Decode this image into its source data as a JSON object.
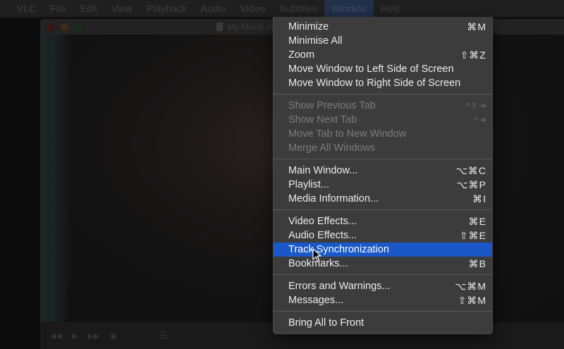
{
  "menubar": {
    "items": [
      "",
      "VLC",
      "File",
      "Edit",
      "View",
      "Playback",
      "Audio",
      "Video",
      "Subtitles",
      "Window",
      "Help"
    ],
    "active_index": 9
  },
  "player": {
    "title": "My Movie.mp4"
  },
  "window_menu": {
    "groups": [
      [
        {
          "label": "Minimize",
          "shortcut": "⌘M",
          "enabled": true
        },
        {
          "label": "Minimise All",
          "shortcut": "",
          "enabled": true
        },
        {
          "label": "Zoom",
          "shortcut": "⇧⌘Z",
          "enabled": true
        },
        {
          "label": "Move Window to Left Side of Screen",
          "shortcut": "",
          "enabled": true
        },
        {
          "label": "Move Window to Right Side of Screen",
          "shortcut": "",
          "enabled": true
        }
      ],
      [
        {
          "label": "Show Previous Tab",
          "shortcut": "^⇧⇥",
          "enabled": false
        },
        {
          "label": "Show Next Tab",
          "shortcut": "^⇥",
          "enabled": false
        },
        {
          "label": "Move Tab to New Window",
          "shortcut": "",
          "enabled": false
        },
        {
          "label": "Merge All Windows",
          "shortcut": "",
          "enabled": false
        }
      ],
      [
        {
          "label": "Main Window...",
          "shortcut": "⌥⌘C",
          "enabled": true
        },
        {
          "label": "Playlist...",
          "shortcut": "⌥⌘P",
          "enabled": true
        },
        {
          "label": "Media Information...",
          "shortcut": "⌘I",
          "enabled": true
        }
      ],
      [
        {
          "label": "Video Effects...",
          "shortcut": "⌘E",
          "enabled": true
        },
        {
          "label": "Audio Effects...",
          "shortcut": "⇧⌘E",
          "enabled": true
        },
        {
          "label": "Track Synchronization",
          "shortcut": "",
          "enabled": true,
          "highlighted": true
        },
        {
          "label": "Bookmarks...",
          "shortcut": "⌘B",
          "enabled": true
        }
      ],
      [
        {
          "label": "Errors and Warnings...",
          "shortcut": "⌥⌘M",
          "enabled": true
        },
        {
          "label": "Messages...",
          "shortcut": "⇧⌘M",
          "enabled": true
        }
      ],
      [
        {
          "label": "Bring All to Front",
          "shortcut": "",
          "enabled": true
        }
      ]
    ]
  },
  "colors": {
    "menu_bg": "#3c3c3c",
    "highlight": "#1a58c7",
    "text": "#ececec",
    "disabled_text": "#7d7d7d"
  },
  "icons": {
    "cursor": "pointer-arrow-icon"
  }
}
